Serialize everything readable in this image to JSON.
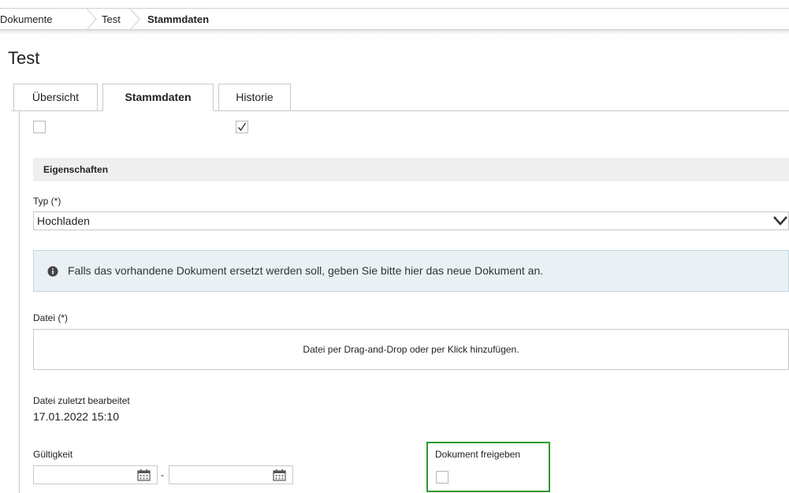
{
  "breadcrumb": {
    "items": [
      "Dokumente",
      "Test",
      "Stammdaten"
    ]
  },
  "page": {
    "title": "Test"
  },
  "tabs": [
    {
      "label": "Übersicht",
      "active": false
    },
    {
      "label": "Stammdaten",
      "active": true
    },
    {
      "label": "Historie",
      "active": false
    }
  ],
  "top_checkboxes": [
    {
      "checked": false
    },
    {
      "checked": true
    }
  ],
  "section": {
    "title": "Eigenschaften"
  },
  "typ": {
    "label": "Typ (*)",
    "value": "Hochladen",
    "icon": "chevron-down-icon"
  },
  "info": {
    "icon": "info-circle-icon",
    "text": "Falls das vorhandene Dokument ersetzt werden soll, geben Sie bitte hier das neue Dokument an."
  },
  "datei": {
    "label": "Datei (*)",
    "dropzone_text": "Datei per Drag-and-Drop oder per Klick hinzufügen."
  },
  "last_edited": {
    "label": "Datei zuletzt bearbeitet",
    "value": "17.01.2022 15:10"
  },
  "gueltigkeit": {
    "label": "Gültigkeit",
    "from": "",
    "to": "",
    "separator": "-",
    "icon": "calendar-icon"
  },
  "freigabe": {
    "label": "Dokument freigeben",
    "checked": false,
    "highlight_color": "#2e9a2e"
  },
  "colors": {
    "border": "#c8c8c8",
    "section_bg": "#efefef",
    "info_bg": "#eaf1f5"
  }
}
